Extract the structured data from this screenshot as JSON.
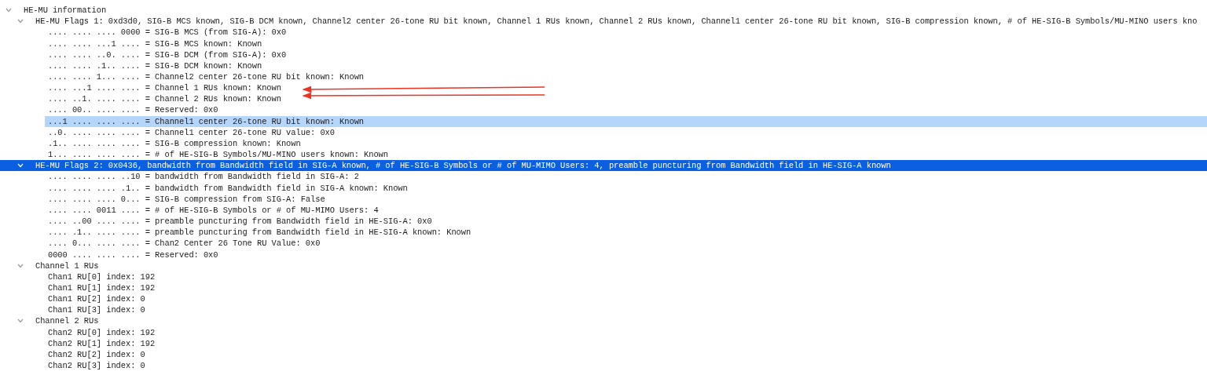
{
  "tree": [
    {
      "text": "HE-MU information",
      "expanded": true,
      "selected": false,
      "related": false,
      "children": [
        {
          "text": "HE-MU Flags 1: 0xd3d0, SIG-B MCS known, SIG-B DCM known, Channel2 center 26-tone RU bit known, Channel 1 RUs known, Channel 2 RUs known, Channel1 center 26-tone RU bit known, SIG-B compression known, # of HE-SIG-B Symbols/MU-MINO users kno",
          "expanded": true,
          "selected": false,
          "related": false,
          "children": [
            {
              "text": ".... .... .... 0000 = SIG-B MCS (from SIG-A): 0x0",
              "selected": false,
              "related": false
            },
            {
              "text": ".... .... ...1 .... = SIG-B MCS known: Known",
              "selected": false,
              "related": false
            },
            {
              "text": ".... .... ..0. .... = SIG-B DCM (from SIG-A): 0x0",
              "selected": false,
              "related": false
            },
            {
              "text": ".... .... .1.. .... = SIG-B DCM known: Known",
              "selected": false,
              "related": false
            },
            {
              "text": ".... .... 1... .... = Channel2 center 26-tone RU bit known: Known",
              "selected": false,
              "related": false
            },
            {
              "text": ".... ...1 .... .... = Channel 1 RUs known: Known",
              "selected": false,
              "related": false
            },
            {
              "text": ".... ..1. .... .... = Channel 2 RUs known: Known",
              "selected": false,
              "related": false
            },
            {
              "text": ".... 00.. .... .... = Reserved: 0x0",
              "selected": false,
              "related": false
            },
            {
              "text": "...1 .... .... .... = Channel1 center 26-tone RU bit known: Known",
              "selected": false,
              "related": true
            },
            {
              "text": "..0. .... .... .... = Channel1 center 26-tone RU value: 0x0",
              "selected": false,
              "related": false
            },
            {
              "text": ".1.. .... .... .... = SIG-B compression known: Known",
              "selected": false,
              "related": false
            },
            {
              "text": "1... .... .... .... = # of HE-SIG-B Symbols/MU-MINO users known: Known",
              "selected": false,
              "related": false
            }
          ]
        },
        {
          "text": "HE-MU Flags 2: 0x0436, bandwidth from Bandwidth field in SIG-A known, # of HE-SIG-B Symbols or # of MU-MIMO Users: 4, preamble puncturing from Bandwidth field in HE-SIG-A known",
          "expanded": true,
          "selected": true,
          "related": false,
          "children": [
            {
              "text": ".... .... .... ..10 = bandwidth from Bandwidth field in SIG-A: 2",
              "selected": false,
              "related": false
            },
            {
              "text": ".... .... .... .1.. = bandwidth from Bandwidth field in SIG-A known: Known",
              "selected": false,
              "related": false
            },
            {
              "text": ".... .... .... 0... = SIG-B compression from SIG-A: False",
              "selected": false,
              "related": false
            },
            {
              "text": ".... .... 0011 .... = # of HE-SIG-B Symbols or # of MU-MIMO Users: 4",
              "selected": false,
              "related": false
            },
            {
              "text": ".... ..00 .... .... = preamble puncturing from Bandwidth field in HE-SIG-A: 0x0",
              "selected": false,
              "related": false
            },
            {
              "text": ".... .1.. .... .... = preamble puncturing from Bandwidth field in HE-SIG-A known: Known",
              "selected": false,
              "related": false
            },
            {
              "text": ".... 0... .... .... = Chan2 Center 26 Tone RU Value: 0x0",
              "selected": false,
              "related": false
            },
            {
              "text": "0000 .... .... .... = Reserved: 0x0",
              "selected": false,
              "related": false
            }
          ]
        },
        {
          "text": "Channel 1 RUs",
          "expanded": true,
          "selected": false,
          "related": false,
          "children": [
            {
              "text": "Chan1 RU[0] index: 192",
              "selected": false,
              "related": false
            },
            {
              "text": "Chan1 RU[1] index: 192",
              "selected": false,
              "related": false
            },
            {
              "text": "Chan1 RU[2] index: 0",
              "selected": false,
              "related": false
            },
            {
              "text": "Chan1 RU[3] index: 0",
              "selected": false,
              "related": false
            }
          ]
        },
        {
          "text": "Channel 2 RUs",
          "expanded": true,
          "selected": false,
          "related": false,
          "children": [
            {
              "text": "Chan2 RU[0] index: 192",
              "selected": false,
              "related": false
            },
            {
              "text": "Chan2 RU[1] index: 192",
              "selected": false,
              "related": false
            },
            {
              "text": "Chan2 RU[2] index: 0",
              "selected": false,
              "related": false
            },
            {
              "text": "Chan2 RU[3] index: 0",
              "selected": false,
              "related": false
            }
          ]
        }
      ]
    }
  ]
}
